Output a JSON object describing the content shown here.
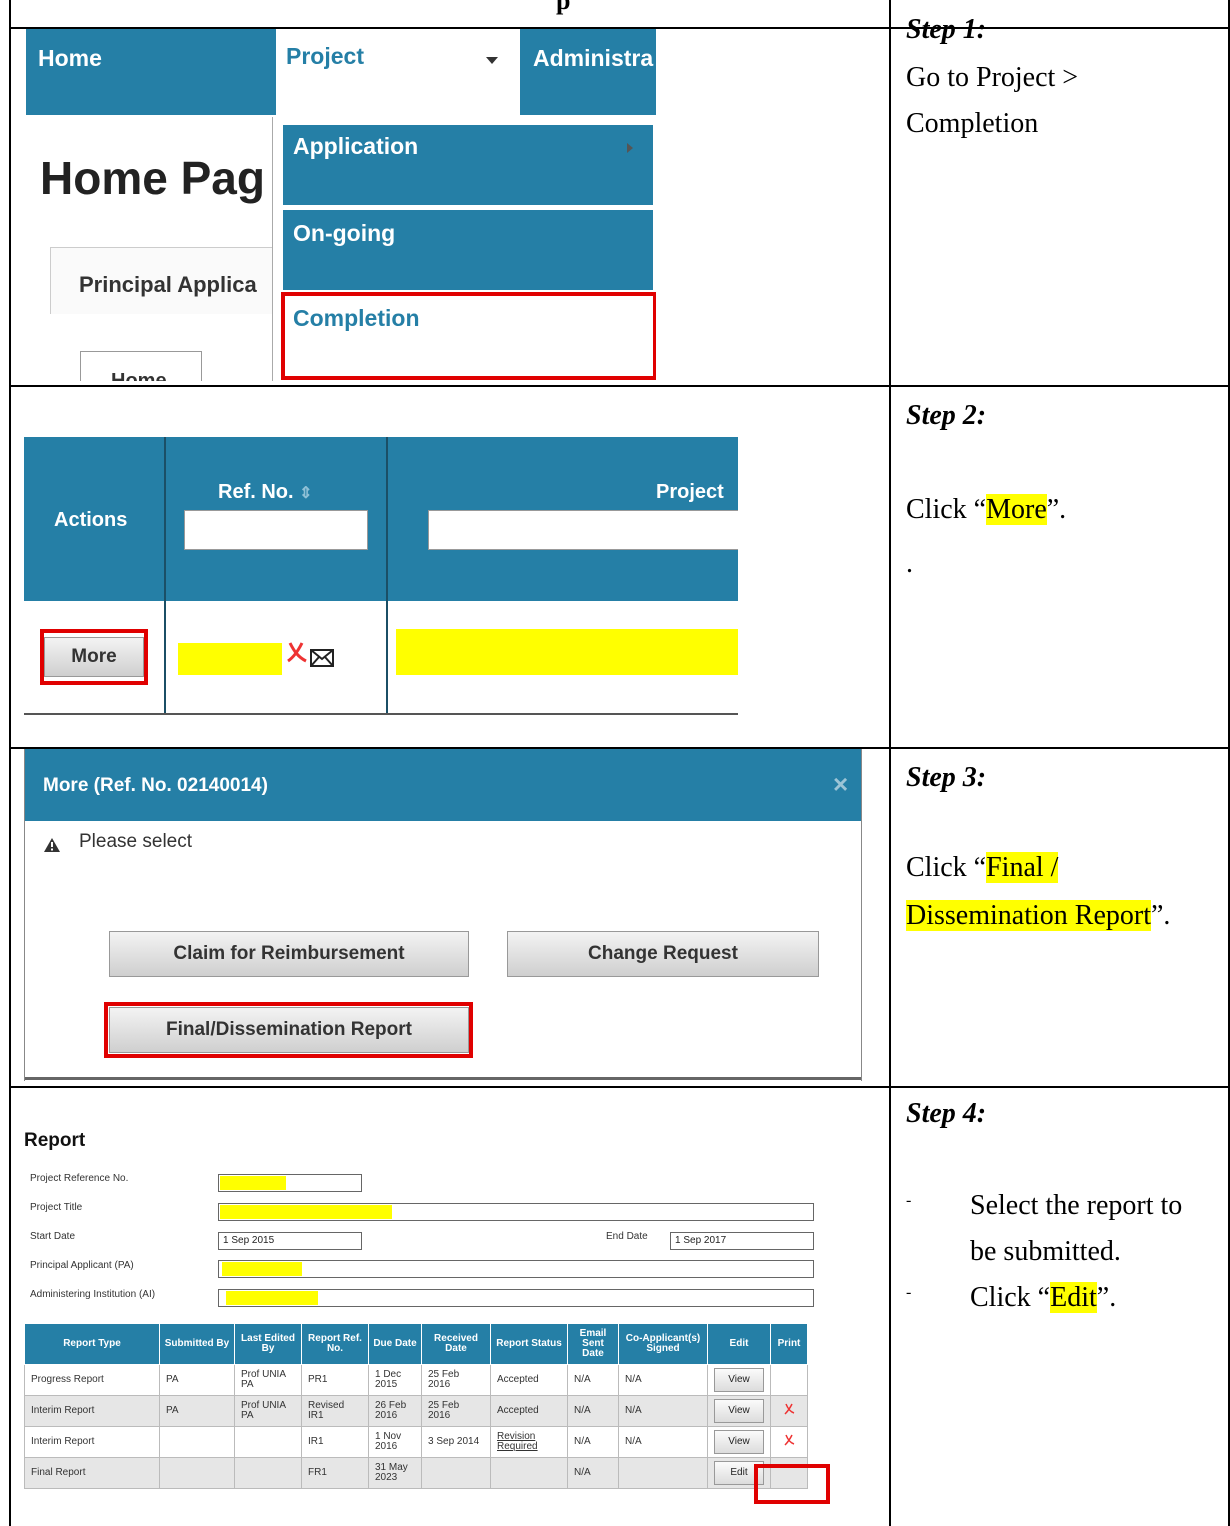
{
  "header_partial": "p",
  "steps": [
    {
      "title": "Step 1:",
      "body_line1": "Go to Project >",
      "body_line2": "Completion"
    },
    {
      "title": "Step 2:",
      "pre": "Click “",
      "hl": "More",
      "post": "”.",
      "extra": "."
    },
    {
      "title": "Step 3:",
      "pre": "Click “",
      "hl1": "Final /",
      "hl2": "Dissemination Report",
      "post": "”."
    },
    {
      "title": "Step 4:",
      "bullet1a": "Select the report to",
      "bullet1b": "be submitted.",
      "bullet2_pre": "Click “",
      "bullet2_hl": "Edit",
      "bullet2_post": "”.",
      "bullet_mark": "-"
    }
  ],
  "s1": {
    "nav_home": "Home",
    "nav_project": "Project",
    "nav_admin": "Administra",
    "page_title": "Home Pag",
    "tab_pa": "Principal Applica",
    "tab_home": "Home",
    "menu": [
      "Application",
      "On-going",
      "Completion"
    ]
  },
  "s2": {
    "col_actions": "Actions",
    "col_ref": "Ref. No.",
    "col_project": "Project",
    "more_label": "More"
  },
  "s3": {
    "dialog_title": "More (Ref. No. 02140014)",
    "close_symbol": "×",
    "warning_text": "Please select",
    "btn_claim": "Claim for Reimbursement",
    "btn_change": "Change Request",
    "btn_final": "Final/Dissemination Report"
  },
  "s4": {
    "heading": "Report",
    "labels": {
      "ref": "Project Reference No.",
      "title": "Project Title",
      "start": "Start Date",
      "end": "End Date",
      "pa": "Principal Applicant (PA)",
      "ai": "Administering Institution (AI)"
    },
    "start_date": "1 Sep 2015",
    "end_date": "1 Sep 2017",
    "columns": [
      "Report Type",
      "Submitted By",
      "Last Edited By",
      "Report Ref. No.",
      "Due Date",
      "Received Date",
      "Report Status",
      "Email Sent Date",
      "Co-Applicant(s) Signed",
      "Edit",
      "Print"
    ],
    "rows": [
      {
        "type": "Progress Report",
        "submitted": "PA",
        "edited": "Prof UNIA PA",
        "ref": "PR1",
        "due": "1 Dec 2015",
        "received": "25 Feb 2016",
        "status": "Accepted",
        "email": "N/A",
        "coapp": "N/A",
        "action": "View",
        "print": false
      },
      {
        "type": "Interim Report",
        "submitted": "PA",
        "edited": "Prof UNIA PA",
        "ref": "Revised IR1",
        "due": "26 Feb 2016",
        "received": "25 Feb 2016",
        "status": "Accepted",
        "email": "N/A",
        "coapp": "N/A",
        "action": "View",
        "print": true
      },
      {
        "type": "Interim Report",
        "submitted": "",
        "edited": "",
        "ref": "IR1",
        "due": "1 Nov 2016",
        "received": "3 Sep 2014",
        "status": "Revision Required",
        "email": "N/A",
        "coapp": "N/A",
        "action": "View",
        "print": true
      },
      {
        "type": "Final Report",
        "submitted": "",
        "edited": "",
        "ref": "FR1",
        "due": "31 May 2023",
        "received": "",
        "status": "",
        "email": "N/A",
        "coapp": "",
        "action": "Edit",
        "print": false
      }
    ]
  },
  "colors": {
    "teal": "#257fa6",
    "red": "#e00000",
    "highlight": "#ffff00"
  }
}
